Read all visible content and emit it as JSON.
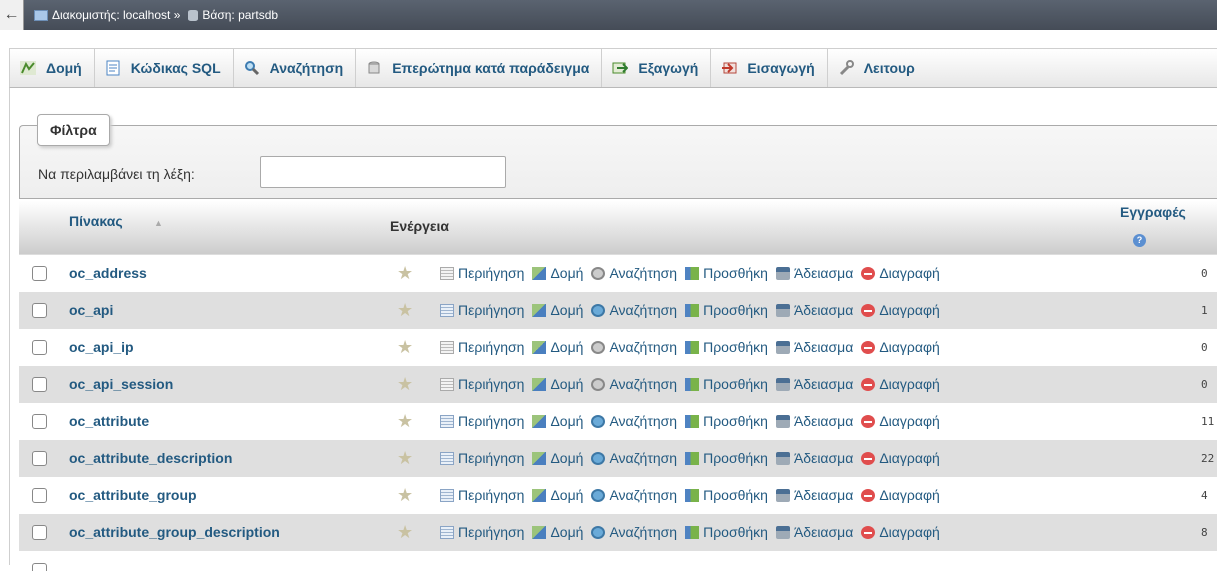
{
  "serverbar": {
    "back_icon": "←",
    "server_label": "Διακομιστής: localhost »",
    "db_label": "Βάση: partsdb"
  },
  "tabs": [
    {
      "label": "Δομή",
      "icon": "structure-icon"
    },
    {
      "label": "Κώδικας SQL",
      "icon": "sql-icon"
    },
    {
      "label": "Αναζήτηση",
      "icon": "search-icon"
    },
    {
      "label": "Επερώτημα κατά παράδειγμα",
      "icon": "query-icon"
    },
    {
      "label": "Εξαγωγή",
      "icon": "export-icon"
    },
    {
      "label": "Εισαγωγή",
      "icon": "import-icon"
    },
    {
      "label": "Λειτουρ",
      "icon": "wrench-icon"
    }
  ],
  "filters": {
    "legend": "Φίλτρα",
    "label": "Να περιλαμβάνει τη λέξη:",
    "value": ""
  },
  "table": {
    "col_table": "Πίνακας",
    "col_action": "Ενέργεια",
    "col_records": "Εγγραφές",
    "actions": {
      "browse": "Περιήγηση",
      "structure": "Δομή",
      "search": "Αναζήτηση",
      "insert": "Προσθήκη",
      "empty": "Άδειασμα",
      "drop": "Διαγραφή"
    },
    "rows": [
      {
        "name": "oc_address",
        "records": "0"
      },
      {
        "name": "oc_api",
        "records": "1"
      },
      {
        "name": "oc_api_ip",
        "records": "0"
      },
      {
        "name": "oc_api_session",
        "records": "0"
      },
      {
        "name": "oc_attribute",
        "records": "11"
      },
      {
        "name": "oc_attribute_description",
        "records": "22"
      },
      {
        "name": "oc_attribute_group",
        "records": "4"
      },
      {
        "name": "oc_attribute_group_description",
        "records": "8"
      }
    ]
  }
}
